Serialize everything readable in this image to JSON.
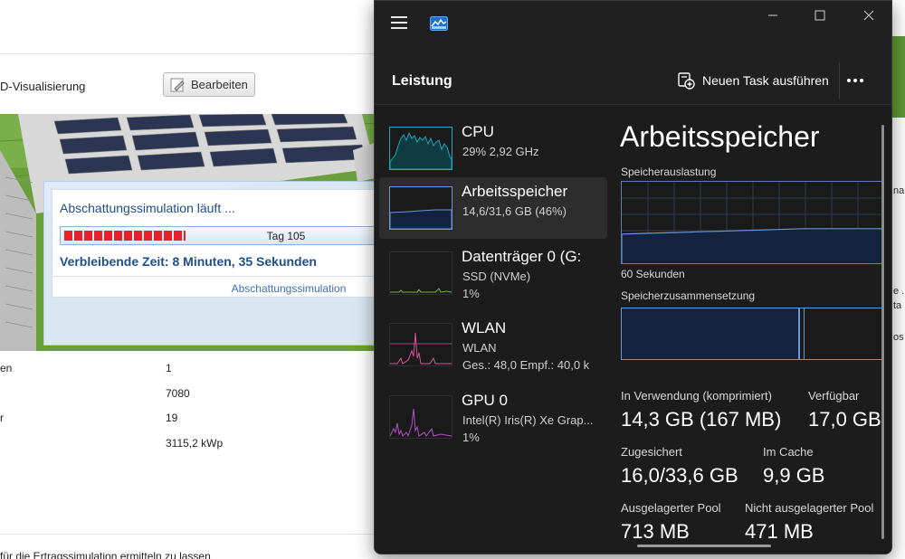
{
  "background_app": {
    "label_3d": "D-Visualisierung",
    "edit_button_label": "Bearbeiten",
    "simulation": {
      "title": "Abschattungssimulation läuft ...",
      "progress_label": "Tag 105",
      "remaining": "Verbleibende Zeit: 8 Minuten, 35 Sekunden",
      "footer": "Abschattungssimulation",
      "progress_fraction": 0.38,
      "bar_color": "#e8202a"
    },
    "table": [
      {
        "key": "en",
        "value": "1"
      },
      {
        "key": "",
        "value": "7080"
      },
      {
        "key": "r",
        "value": "19"
      },
      {
        "key": "",
        "value": "3115,2 kWp"
      }
    ],
    "bottom_text": "für die Ertragssimulation ermitteln zu lassen",
    "right_fragments": [
      "na",
      "e .",
      "ta",
      "os"
    ]
  },
  "task_manager": {
    "section_title": "Leistung",
    "run_task_label": "Neuen Task ausführen",
    "sidebar": [
      {
        "name": "CPU",
        "sub": "29%  2,92 GHz",
        "sub2": "",
        "color": "#1aa7b9",
        "selected": false
      },
      {
        "name": "Arbeitsspeicher",
        "sub": "14,6/31,6 GB (46%)",
        "sub2": "",
        "color": "#6b96d4",
        "selected": true
      },
      {
        "name": "Datenträger 0 (G:",
        "sub": "SSD (NVMe)",
        "sub2": "1%",
        "color": "#6cbf3a",
        "selected": false
      },
      {
        "name": "WLAN",
        "sub": "WLAN",
        "sub2": "Ges.: 48,0  Empf.: 40,0 k",
        "color": "#d9549d",
        "selected": false
      },
      {
        "name": "GPU 0",
        "sub": "Intel(R) Iris(R) Xe Grap...",
        "sub2": "1%",
        "color": "#b74ec9",
        "selected": false
      }
    ],
    "detail": {
      "title": "Arbeitsspeicher",
      "usage_label": "Speicherauslastung",
      "time_label": "60 Sekunden",
      "composition_label": "Speicherzusammensetzung",
      "in_use_label": "In Verwendung (komprimiert)",
      "in_use_value": "14,3 GB (167 MB)",
      "available_label": "Verfügbar",
      "available_value": "17,0 GB",
      "committed_label": "Zugesichert",
      "committed_value": "16,0/33,6 GB",
      "cached_label": "Im Cache",
      "cached_value": "9,9 GB",
      "paged_pool_label": "Ausgelagerter Pool",
      "paged_pool_value": "713 MB",
      "nonpaged_pool_label": "Nicht ausgelagerter Pool",
      "nonpaged_pool_value": "471 MB",
      "usage_fraction": 0.46
    }
  }
}
